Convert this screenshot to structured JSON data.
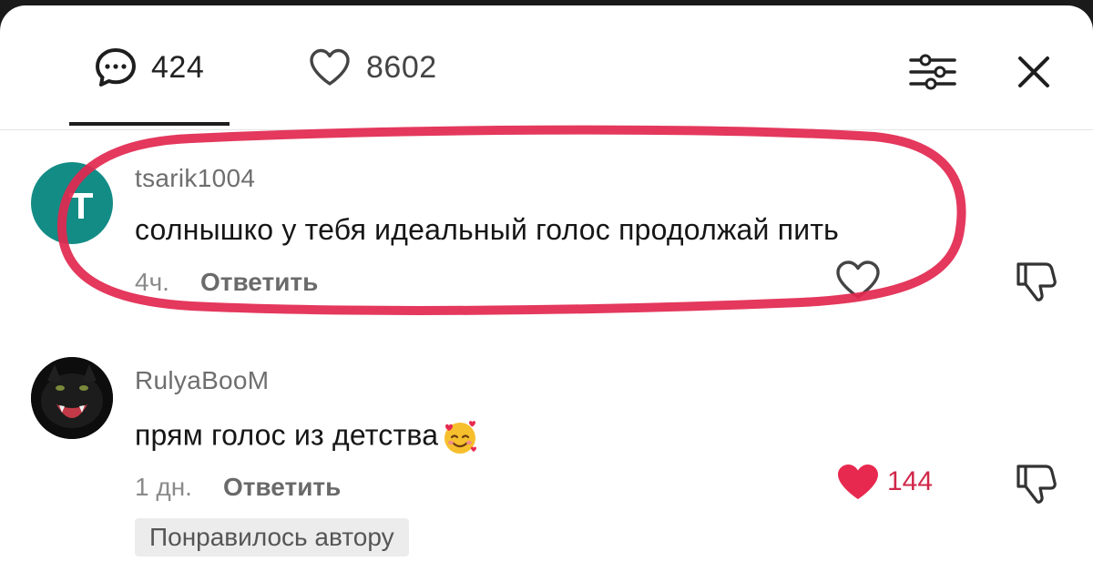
{
  "header": {
    "comments_count": "424",
    "likes_count": "8602",
    "icons": {
      "comments": "comment-bubble-icon",
      "likes": "heart-outline-icon",
      "filter": "filter-sliders-icon",
      "close": "close-icon"
    }
  },
  "comments": [
    {
      "username": "tsarik1004",
      "text": "солнышко у тебя идеальный голос продолжай пить",
      "time": "4ч.",
      "reply_label": "Ответить",
      "avatar_color": "#138c86",
      "avatar_letter": "T",
      "liked": false
    },
    {
      "username": "RulyaBooM",
      "text": "прям голос из детства",
      "emoji": "smiling-face-with-hearts",
      "time": "1 дн.",
      "reply_label": "Ответить",
      "like_count": "144",
      "liked": true,
      "badge": "Понравилось автору"
    }
  ],
  "colors": {
    "liked_heart": "#e8294f",
    "highlight_stroke": "#e2274f",
    "avatar_teal": "#138c86"
  }
}
